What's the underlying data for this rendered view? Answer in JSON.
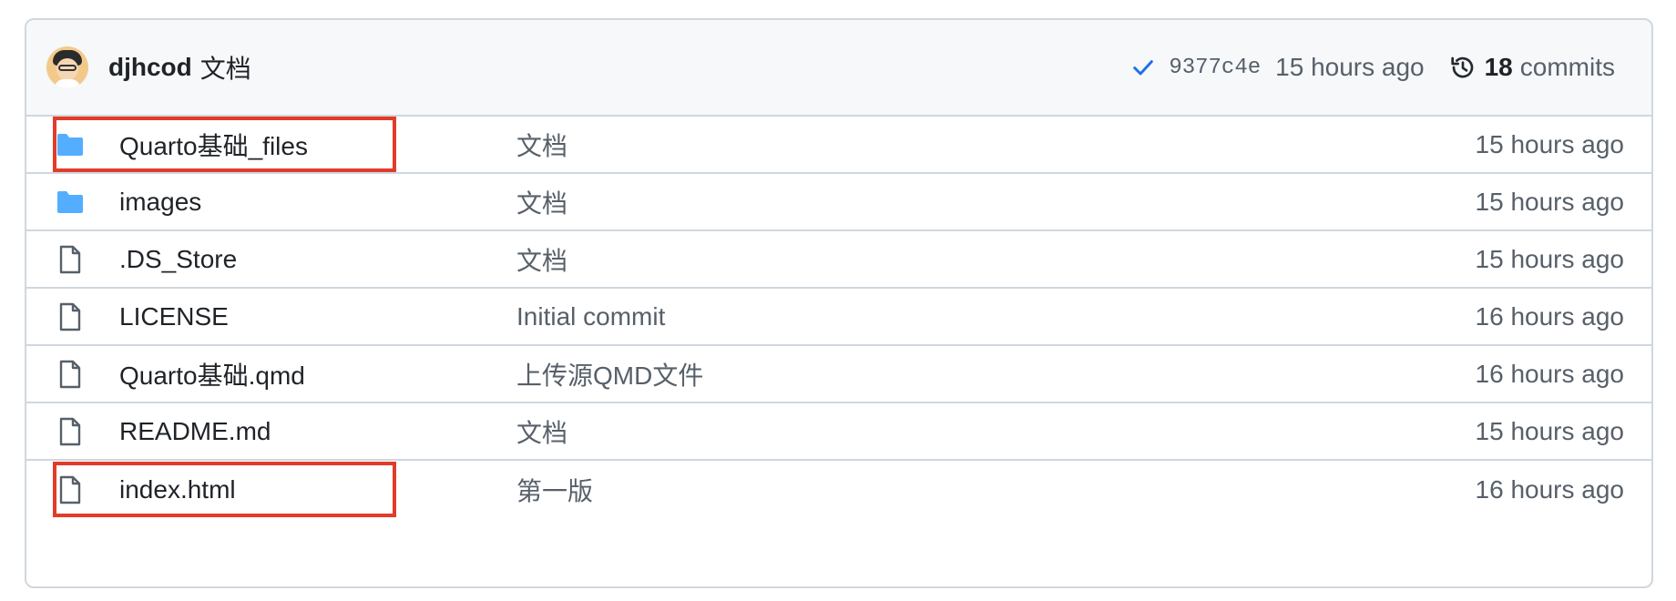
{
  "commit": {
    "author": "djhcod",
    "message": "文档",
    "status_icon": "check-icon",
    "sha": "9377c4e",
    "time": "15 hours ago",
    "history_icon": "history-icon",
    "count": "18",
    "count_label": "commits"
  },
  "files": [
    {
      "name": "Quarto基础_files",
      "type": "folder",
      "icon": "folder-icon",
      "commit": "文档",
      "time": "15 hours ago",
      "highlighted": true
    },
    {
      "name": "images",
      "type": "folder",
      "icon": "folder-icon",
      "commit": "文档",
      "time": "15 hours ago",
      "highlighted": false
    },
    {
      "name": ".DS_Store",
      "type": "file",
      "icon": "file-icon",
      "commit": "文档",
      "time": "15 hours ago",
      "highlighted": false
    },
    {
      "name": "LICENSE",
      "type": "file",
      "icon": "file-icon",
      "commit": "Initial commit",
      "time": "16 hours ago",
      "highlighted": false
    },
    {
      "name": "Quarto基础.qmd",
      "type": "file",
      "icon": "file-icon",
      "commit": "上传源QMD文件",
      "time": "16 hours ago",
      "highlighted": false
    },
    {
      "name": "README.md",
      "type": "file",
      "icon": "file-icon",
      "commit": "文档",
      "time": "15 hours ago",
      "highlighted": false
    },
    {
      "name": "index.html",
      "type": "file",
      "icon": "file-icon",
      "commit": "第一版",
      "time": "16 hours ago",
      "highlighted": true
    }
  ],
  "colors": {
    "folder": "#54aeff",
    "file_icon": "#57606a",
    "check": "#1f6feb",
    "highlight": "#e23b2a",
    "border": "#d0d7de",
    "header_bg": "#f6f8fa"
  }
}
